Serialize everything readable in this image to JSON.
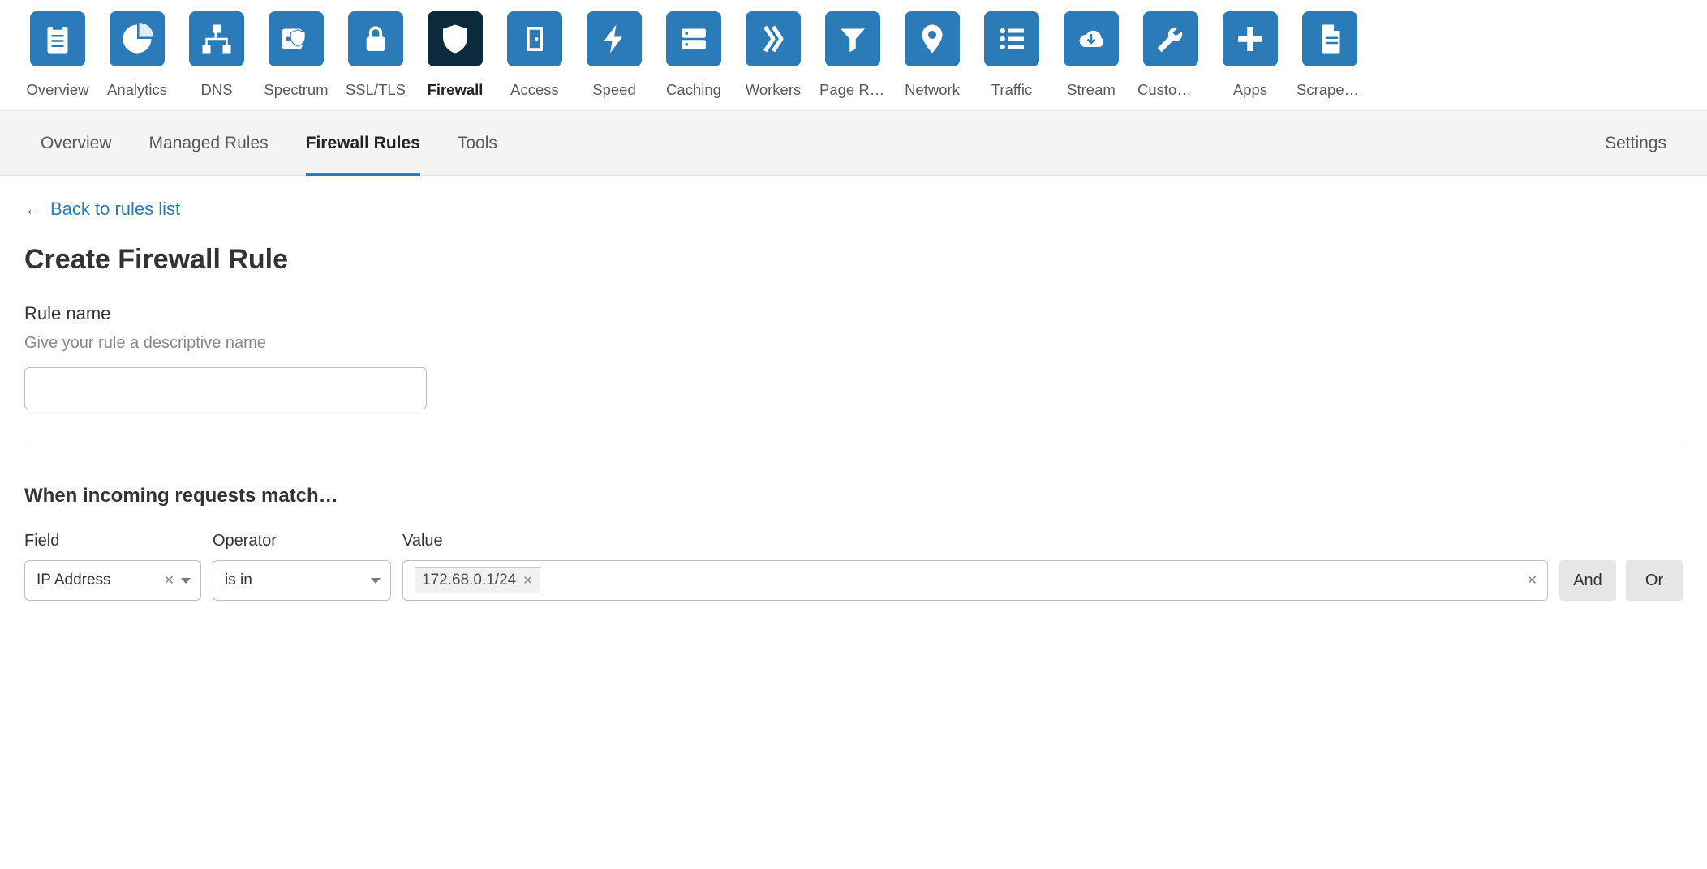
{
  "top_nav": [
    {
      "label": "Overview",
      "icon": "clipboard",
      "active": false
    },
    {
      "label": "Analytics",
      "icon": "pie",
      "active": false
    },
    {
      "label": "DNS",
      "icon": "sitemap",
      "active": false
    },
    {
      "label": "Spectrum",
      "icon": "server-shield",
      "active": false
    },
    {
      "label": "SSL/TLS",
      "icon": "lock",
      "active": false
    },
    {
      "label": "Firewall",
      "icon": "shield",
      "active": true
    },
    {
      "label": "Access",
      "icon": "door",
      "active": false
    },
    {
      "label": "Speed",
      "icon": "bolt",
      "active": false
    },
    {
      "label": "Caching",
      "icon": "drive",
      "active": false
    },
    {
      "label": "Workers",
      "icon": "workers",
      "active": false
    },
    {
      "label": "Page Rules",
      "icon": "funnel",
      "active": false
    },
    {
      "label": "Network",
      "icon": "marker",
      "active": false
    },
    {
      "label": "Traffic",
      "icon": "list",
      "active": false
    },
    {
      "label": "Stream",
      "icon": "cloud",
      "active": false
    },
    {
      "label": "Custom P…",
      "icon": "wrench",
      "active": false
    },
    {
      "label": "Apps",
      "icon": "plus",
      "active": false
    },
    {
      "label": "Scrape S…",
      "icon": "doc",
      "active": false
    }
  ],
  "sub_tabs": {
    "items": [
      {
        "label": "Overview",
        "active": false
      },
      {
        "label": "Managed Rules",
        "active": false
      },
      {
        "label": "Firewall Rules",
        "active": true
      },
      {
        "label": "Tools",
        "active": false
      }
    ],
    "settings": "Settings"
  },
  "back_link": "Back to rules list",
  "page_title": "Create Firewall Rule",
  "rule_name": {
    "label": "Rule name",
    "help": "Give your rule a descriptive name",
    "value": ""
  },
  "match_heading": "When incoming requests match…",
  "condition": {
    "field_label": "Field",
    "operator_label": "Operator",
    "value_label": "Value",
    "field": "IP Address",
    "operator": "is in",
    "values": [
      "172.68.0.1/24"
    ]
  },
  "logic_buttons": {
    "and": "And",
    "or": "Or"
  }
}
